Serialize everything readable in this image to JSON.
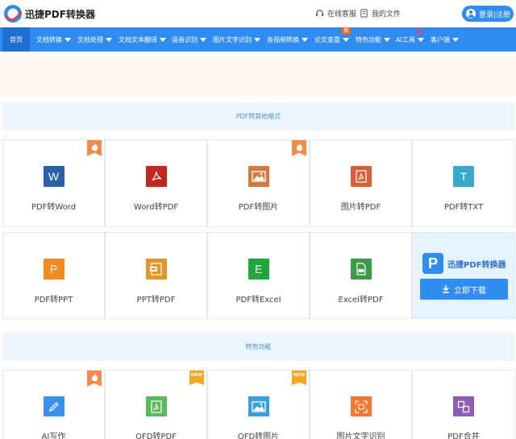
{
  "header": {
    "brand": "迅捷PDF转换器",
    "service_label": "在线客服",
    "files_label": "我的文件",
    "login_label": "登录|注册"
  },
  "nav": {
    "items": [
      {
        "label": "首页",
        "active": true
      },
      {
        "label": "文档转换"
      },
      {
        "label": "文档处理"
      },
      {
        "label": "文档文本翻译"
      },
      {
        "label": "语音识别"
      },
      {
        "label": "图片文字识别"
      },
      {
        "label": "音视频转换"
      },
      {
        "label": "论文查重",
        "badge": "新"
      },
      {
        "label": "特色功能"
      },
      {
        "label": "AI工具"
      },
      {
        "label": "客户端"
      }
    ]
  },
  "sections": {
    "convert_title": "PDF转其他格式",
    "features_title": "特色功能"
  },
  "convert_tools": [
    {
      "label": "PDF转Word",
      "icon": "word-icon",
      "glyph": "W",
      "color": "#2b5faa",
      "tag": "hot"
    },
    {
      "label": "Word转PDF",
      "icon": "pdf-icon",
      "glyph": "",
      "color": "#c0271e"
    },
    {
      "label": "PDF转图片",
      "icon": "image-icon",
      "glyph": "",
      "color": "#d27a3f",
      "tag": "hot"
    },
    {
      "label": "图片转PDF",
      "icon": "pdf-icon",
      "glyph": "",
      "color": "#d9613a"
    },
    {
      "label": "PDF转TXT",
      "icon": "txt-icon",
      "glyph": "T",
      "color": "#3aa8c8"
    },
    {
      "label": "PDF转PPT",
      "icon": "ppt-icon",
      "glyph": "P",
      "color": "#f28b1e"
    },
    {
      "label": "PPT转PDF",
      "icon": "ppt-pdf-icon",
      "glyph": "",
      "color": "#e6952a"
    },
    {
      "label": "PDF转Excel",
      "icon": "excel-icon",
      "glyph": "E",
      "color": "#1ea83a"
    },
    {
      "label": "Excel转PDF",
      "icon": "excel-pdf-icon",
      "glyph": "",
      "color": "#3c9b49"
    }
  ],
  "promo": {
    "name": "迅捷PDF转换器",
    "download_label": "立即下载"
  },
  "feature_tools": [
    {
      "label": "AI写作",
      "icon": "pen-icon",
      "color": "#3b8ff0",
      "tag": "hot"
    },
    {
      "label": "OFD转PDF",
      "icon": "pdf-icon",
      "color": "#5cb85c",
      "tag": "new"
    },
    {
      "label": "OFD转图片",
      "icon": "image-icon",
      "color": "#3a9fd8",
      "tag": "new"
    },
    {
      "label": "图片文字识别",
      "icon": "scan-icon",
      "color": "#f5782e"
    },
    {
      "label": "PDF合并",
      "icon": "merge-icon",
      "color": "#8e5bb8"
    }
  ],
  "badges": {
    "new_text": "NEW"
  }
}
